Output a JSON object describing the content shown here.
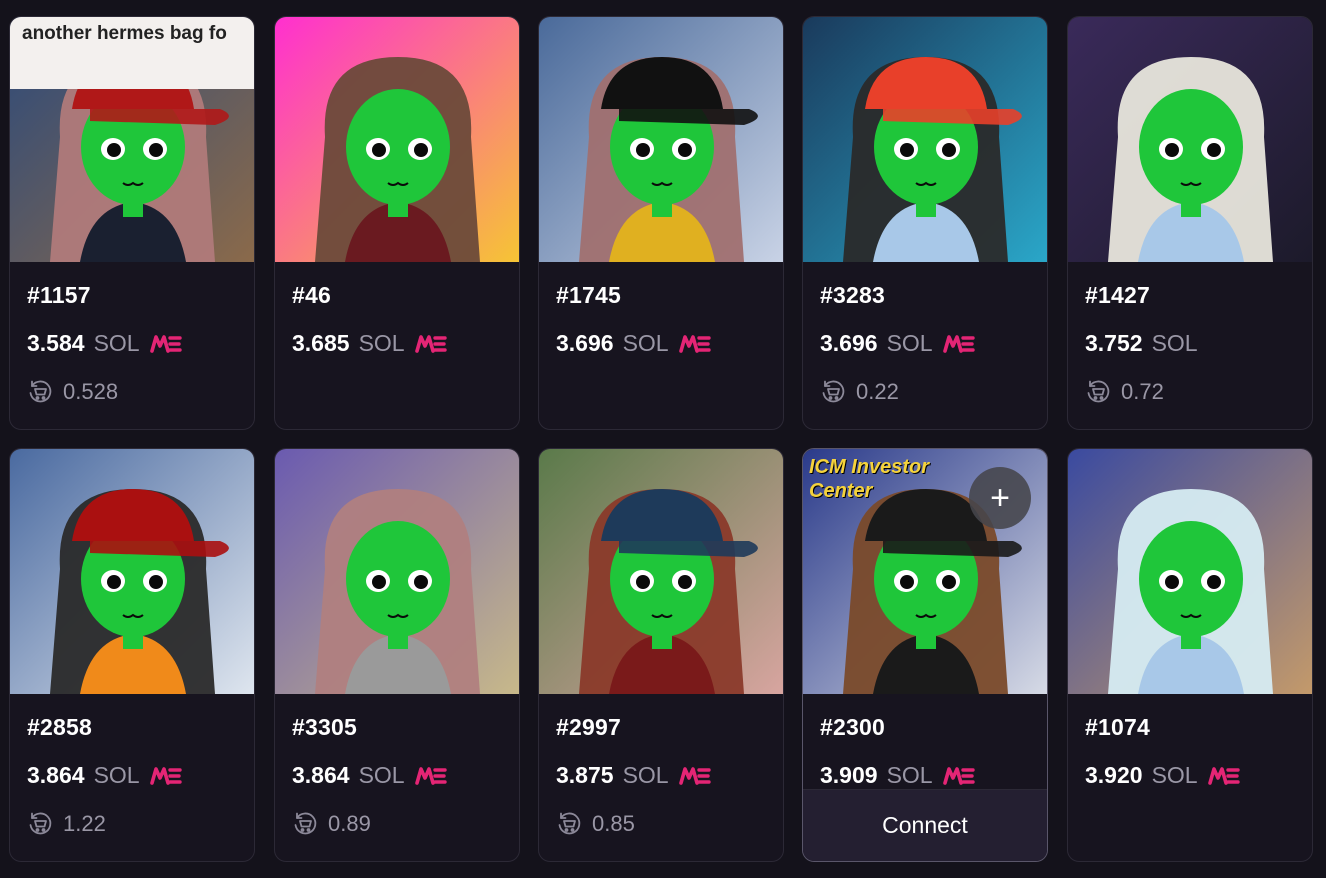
{
  "currency": "SOL",
  "accent_color": "#e42575",
  "card_background": "#17141f",
  "page_background": "#14121b",
  "items": [
    {
      "name": "#1157",
      "price": "3.584",
      "marketplace": "magic-eden-logo",
      "offer": "0.528",
      "image_text": "another hermes bag fo",
      "bg": [
        "#2d4a7a",
        "#8b6a4a"
      ]
    },
    {
      "name": "#46",
      "price": "3.685",
      "marketplace": "magic-eden-logo",
      "offer": null,
      "bg": [
        "#ff2fd0",
        "#f6c534"
      ]
    },
    {
      "name": "#1745",
      "price": "3.696",
      "marketplace": "magic-eden-logo",
      "offer": null,
      "bg": [
        "#4a6a9a",
        "#c9d3e6"
      ]
    },
    {
      "name": "#3283",
      "price": "3.696",
      "marketplace": "magic-eden-logo",
      "offer": "0.22",
      "bg": [
        "#1a3a5c",
        "#2aa7c9"
      ]
    },
    {
      "name": "#1427",
      "price": "3.752",
      "marketplace": null,
      "offer": "0.72",
      "bg": [
        "#3a2a5a",
        "#1c1a2a"
      ]
    },
    {
      "name": "#2858",
      "price": "3.864",
      "marketplace": "magic-eden-logo",
      "offer": "1.22",
      "bg": [
        "#4a6aa0",
        "#dfe6ef"
      ]
    },
    {
      "name": "#3305",
      "price": "3.864",
      "marketplace": "magic-eden-logo",
      "offer": "0.89",
      "bg": [
        "#6a5ab0",
        "#c8b98a"
      ]
    },
    {
      "name": "#2997",
      "price": "3.875",
      "marketplace": "magic-eden-logo",
      "offer": "0.85",
      "bg": [
        "#5a7a4a",
        "#d8a5a0"
      ]
    },
    {
      "name": "#2300",
      "price": "3.909",
      "marketplace": "magic-eden-logo",
      "offer": null,
      "image_text": "ICM Investor Center",
      "connect_label": "Connect",
      "plus_label": "+",
      "bg": [
        "#2a3a8a",
        "#d7dbe6"
      ]
    },
    {
      "name": "#1074",
      "price": "3.920",
      "marketplace": "magic-eden-logo",
      "offer": null,
      "bg": [
        "#3a4aa0",
        "#c49a6a"
      ]
    }
  ]
}
